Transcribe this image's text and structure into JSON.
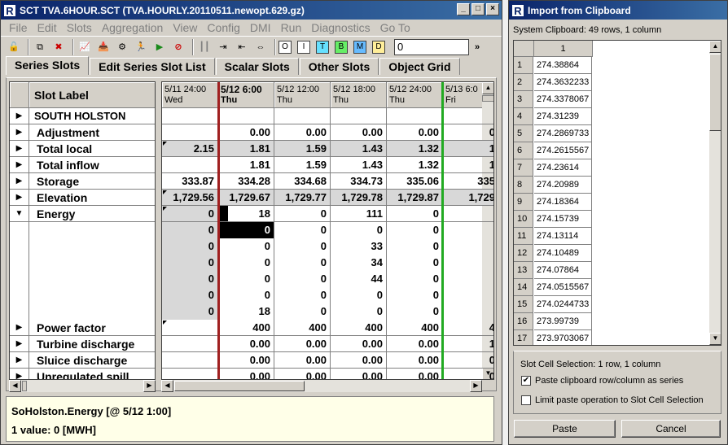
{
  "main": {
    "title": "SCT TVA.6HOUR.SCT (TVA.HOURLY.20110511.newopt.629.gz)",
    "menu": [
      "File",
      "Edit",
      "Slots",
      "Aggregation",
      "View",
      "Config",
      "DMI",
      "Run",
      "Diagnostics",
      "Go To"
    ],
    "toolbar_letters": [
      "O",
      "I",
      "T",
      "B",
      "M",
      "D"
    ],
    "toolbar_letter_colors": [
      "#ffffff",
      "#ffffff",
      "#66e0ff",
      "#66ee66",
      "#66bbff",
      "#ffee99"
    ],
    "toolbar_input": "0",
    "tabs": [
      "Series Slots",
      "Edit Series Slot List",
      "Scalar Slots",
      "Other Slots",
      "Object Grid"
    ],
    "slot_label_header": "Slot Label",
    "columns": [
      {
        "date": "5/11 24:00",
        "day": "Wed",
        "bold": false
      },
      {
        "date": "5/12 6:00",
        "day": "Thu",
        "bold": true
      },
      {
        "date": "5/12 12:00",
        "day": "Thu",
        "bold": false
      },
      {
        "date": "5/12 18:00",
        "day": "Thu",
        "bold": false
      },
      {
        "date": "5/12 24:00",
        "day": "Thu",
        "bold": false
      },
      {
        "date": "5/13 6:0",
        "day": "Fri",
        "bold": false
      }
    ],
    "rows": [
      {
        "arrow": "▶",
        "name": "SOUTH HOLSTON",
        "values": [
          "",
          "",
          "",
          "",
          "",
          ""
        ]
      },
      {
        "arrow": "▶",
        "name": "Adjustment",
        "values": [
          "",
          "0.00",
          "0.00",
          "0.00",
          "0.00",
          "0"
        ]
      },
      {
        "arrow": "▶",
        "name": "Total local",
        "values": [
          "2.15",
          "1.81",
          "1.59",
          "1.43",
          "1.32",
          "1"
        ]
      },
      {
        "arrow": "▶",
        "name": "Total inflow",
        "values": [
          "",
          "1.81",
          "1.59",
          "1.43",
          "1.32",
          "1"
        ]
      },
      {
        "arrow": "▶",
        "name": "Storage",
        "values": [
          "333.87",
          "334.28",
          "334.68",
          "334.73",
          "335.06",
          "335"
        ]
      },
      {
        "arrow": "▶",
        "name": "Elevation",
        "values": [
          "1,729.56",
          "1,729.67",
          "1,729.77",
          "1,729.78",
          "1,729.87",
          "1,729"
        ]
      },
      {
        "arrow": "▼",
        "name": "Energy",
        "values": [
          "0",
          "18",
          "0",
          "111",
          "0",
          ""
        ]
      },
      {
        "arrow": "",
        "name": "",
        "values": [
          "0",
          "0",
          "0",
          "0",
          "0",
          ""
        ]
      },
      {
        "arrow": "",
        "name": "",
        "values": [
          "0",
          "0",
          "0",
          "33",
          "0",
          ""
        ]
      },
      {
        "arrow": "",
        "name": "",
        "values": [
          "0",
          "0",
          "0",
          "34",
          "0",
          ""
        ]
      },
      {
        "arrow": "",
        "name": "",
        "values": [
          "0",
          "0",
          "0",
          "44",
          "0",
          ""
        ]
      },
      {
        "arrow": "",
        "name": "",
        "values": [
          "0",
          "0",
          "0",
          "0",
          "0",
          ""
        ]
      },
      {
        "arrow": "",
        "name": "",
        "values": [
          "0",
          "18",
          "0",
          "0",
          "0",
          ""
        ]
      },
      {
        "arrow": "▶",
        "name": "Power factor",
        "values": [
          "",
          "400",
          "400",
          "400",
          "400",
          "4"
        ]
      },
      {
        "arrow": "▶",
        "name": "Turbine discharge",
        "values": [
          "",
          "0.00",
          "0.00",
          "0.00",
          "0.00",
          "1"
        ]
      },
      {
        "arrow": "▶",
        "name": "Sluice discharge",
        "values": [
          "",
          "0.00",
          "0.00",
          "0.00",
          "0.00",
          "0"
        ]
      },
      {
        "arrow": "▶",
        "name": "Unregulated spill",
        "values": [
          "",
          "0.00",
          "0.00",
          "0.00",
          "0.00",
          "0"
        ]
      }
    ],
    "status_line1": "SoHolston.Energy [@ 5/12 1:00]",
    "status_line2": "1 value:  0 [MWH]"
  },
  "dialog": {
    "title": "Import from Clipboard",
    "clipboard_info": "System Clipboard:  49 rows, 1 column",
    "col_header": "1",
    "rows": [
      {
        "n": "1",
        "v": "274.38864"
      },
      {
        "n": "2",
        "v": "274.3632233"
      },
      {
        "n": "3",
        "v": "274.3378067"
      },
      {
        "n": "4",
        "v": "274.31239"
      },
      {
        "n": "5",
        "v": "274.2869733"
      },
      {
        "n": "6",
        "v": "274.2615567"
      },
      {
        "n": "7",
        "v": "274.23614"
      },
      {
        "n": "8",
        "v": "274.20989"
      },
      {
        "n": "9",
        "v": "274.18364"
      },
      {
        "n": "10",
        "v": "274.15739"
      },
      {
        "n": "11",
        "v": "274.13114"
      },
      {
        "n": "12",
        "v": "274.10489"
      },
      {
        "n": "13",
        "v": "274.07864"
      },
      {
        "n": "14",
        "v": "274.0515567"
      },
      {
        "n": "15",
        "v": "274.0244733"
      },
      {
        "n": "16",
        "v": "273.99739"
      },
      {
        "n": "17",
        "v": "273.9703067"
      }
    ],
    "selection_info": "Slot Cell Selection:  1 row, 1 column",
    "paste_as_series_label": "Paste clipboard row/column as series",
    "limit_paste_label": "Limit paste operation to Slot Cell Selection",
    "paste_label": "Paste",
    "cancel_label": "Cancel"
  },
  "colors": {
    "titlebar": "#0a246a",
    "selected_cell": "#000000",
    "input_cell": "#d8d8d8",
    "current_time_line": "#a02020",
    "run_start_line": "#22aa22"
  }
}
